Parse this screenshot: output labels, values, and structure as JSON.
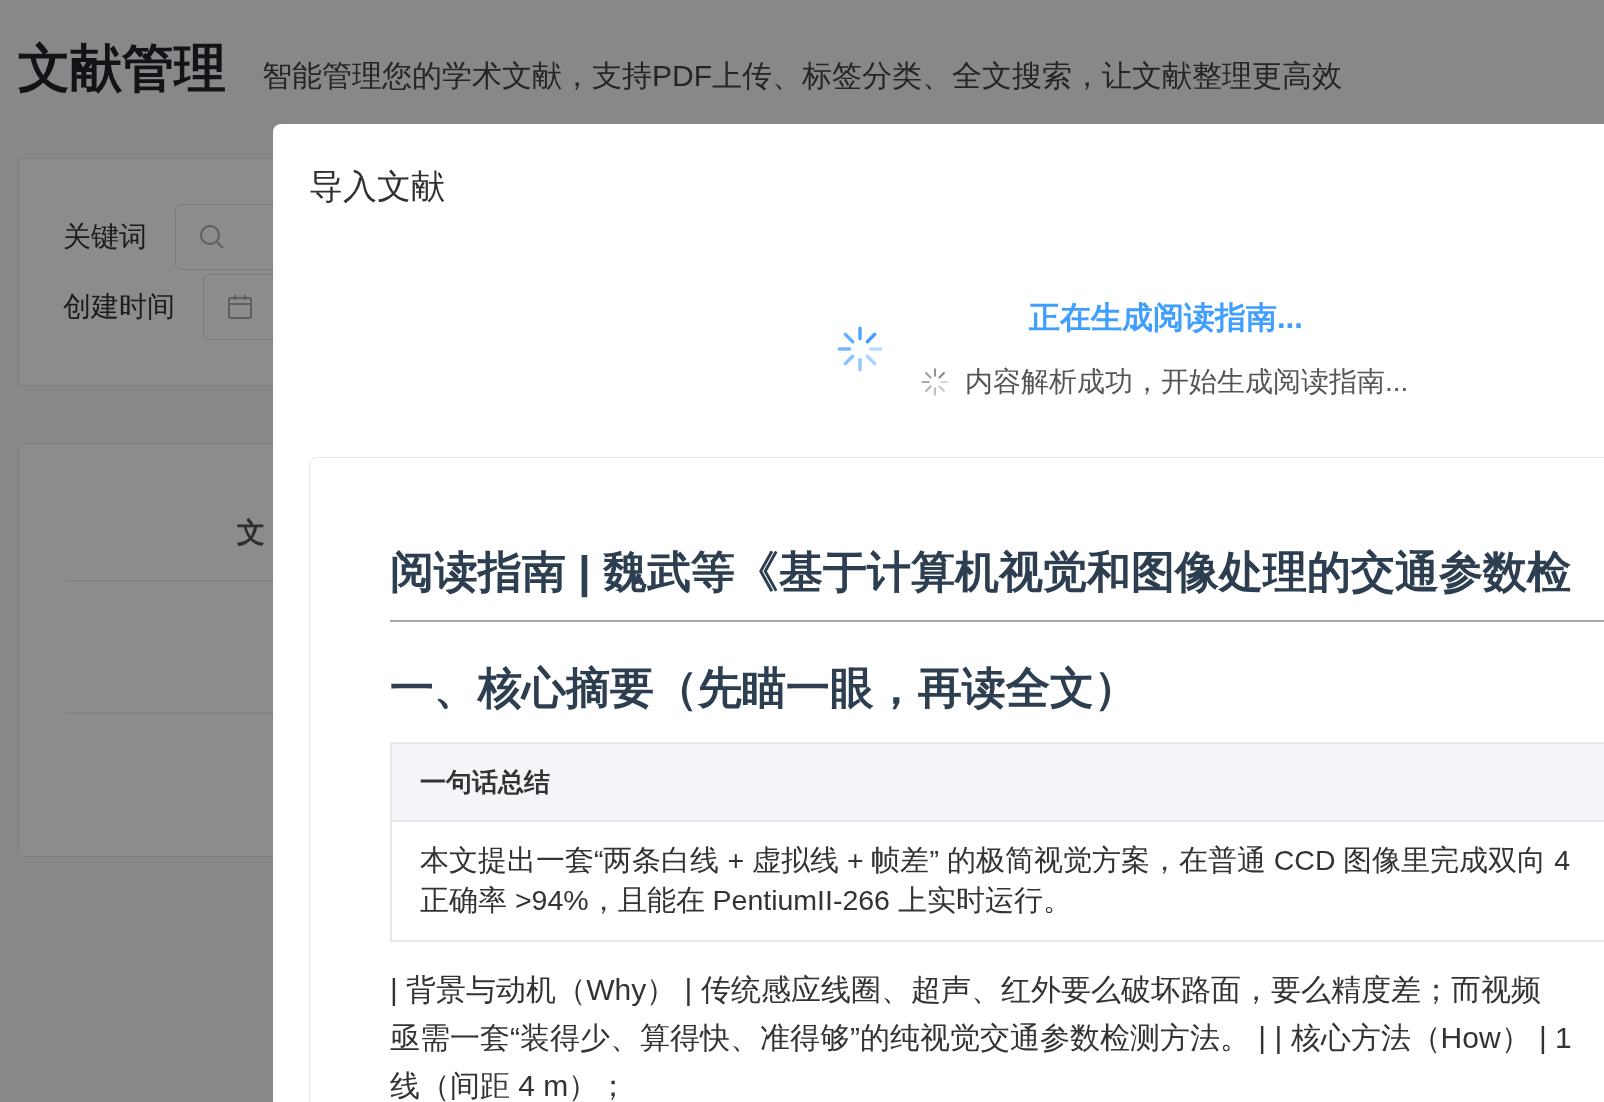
{
  "page": {
    "title": "文献管理",
    "subtitle": "智能管理您的学术文献，支持PDF上传、标签分类、全文搜索，让文献整理更高效"
  },
  "filters": [
    {
      "kind": "search",
      "label": "关键词"
    },
    {
      "kind": "date",
      "label": "创建时间"
    }
  ],
  "table": {
    "columns": [
      "文"
    ]
  },
  "dialog": {
    "title": "导入文献",
    "status": "正在生成阅读指南...",
    "step": "内容解析成功，开始生成阅读指南...",
    "guide": {
      "title": "阅读指南 | 魏武等《基于计算机视觉和图像处理的交通参数检",
      "section": "一、核心摘要（先瞄一眼，再读全文）",
      "summary": {
        "header": "一句话总结",
        "lines": [
          "本文提出一套“两条白线 + 虚拟线 + 帧差” 的极简视觉方案，在普通 CCD 图像里完成双向 4",
          "正确率 >94%，且能在 PentiumII-266 上实时运行。"
        ]
      },
      "paragraph_lines": [
        "| 背景与动机（Why） | 传统感应线圈、超声、红外要么破坏路面，要么精度差；而视频",
        "亟需一套“装得少、算得快、准得够”的纯视觉交通参数检测方法。 | | 核心方法（How） | 1",
        "线（间距 4 m）；"
      ]
    }
  }
}
